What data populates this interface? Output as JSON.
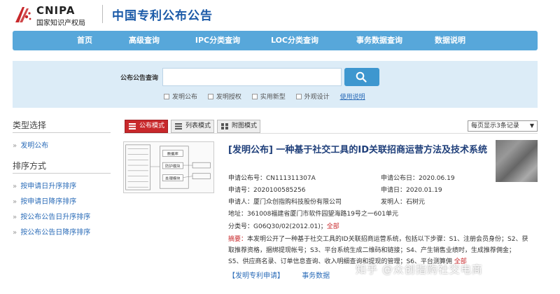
{
  "header": {
    "logo_text": "CNIPA",
    "logo_subtitle": "国家知识产权局",
    "site_title": "中国专利公布公告"
  },
  "nav": {
    "items": [
      "首页",
      "高级查询",
      "IPC分类查询",
      "LOC分类查询",
      "事务数据查询",
      "数据说明"
    ]
  },
  "search": {
    "label": "公布公告查询",
    "value": "",
    "options": [
      {
        "label": "发明公布",
        "checked": false
      },
      {
        "label": "发明授权",
        "checked": false
      },
      {
        "label": "实用新型",
        "checked": false
      },
      {
        "label": "外观设计",
        "checked": false
      }
    ],
    "help_link": "使用说明"
  },
  "sidebar": {
    "type_heading": "类型选择",
    "type_items": [
      "发明公布"
    ],
    "sort_heading": "排序方式",
    "sort_items": [
      "按申请日升序排序",
      "按申请日降序排序",
      "按公布公告日升序排序",
      "按公布公告日降序排序"
    ]
  },
  "toolbar": {
    "modes": [
      "公布模式",
      "列表模式",
      "附图模式"
    ],
    "active_mode": "公布模式",
    "per_page": "每页显示3条记录"
  },
  "result": {
    "title": "[发明公布] 一种基于社交工具的ID关联招商运营方法及技术系统",
    "pub_no_label": "申请公布号：",
    "pub_no": "CN111311307A",
    "pub_date_label": "申请公布日：",
    "pub_date": "2020.06.19",
    "app_no_label": "申请号：",
    "app_no": "2020100585256",
    "app_date_label": "申请日：",
    "app_date": "2020.01.19",
    "applicant_label": "申请人：",
    "applicant": "厦门众创指购科技股份有限公司",
    "inventor_label": "发明人：",
    "inventor": "石树元",
    "address_label": "地址：",
    "address": "361008福建省厦门市软件园望海路19号之一601单元",
    "class_label": "分类号：",
    "class_no": "G06Q30/02(2012.01)；",
    "class_all": "全部",
    "abstract_label": "摘要：",
    "abstract": "本发明公开了一种基于社交工具的ID关联招商运营系统，包括以下步骤：S1、注册会员身份；S2、获取推荐资格，捆绑提现帐号；S3、平台系统生成二维码和链接；S4、产生销售业绩时，生成推荐佣金；S5、供应商名录、订单信息查询、收入明细查询和提现的管理；S6、平台测算佣",
    "abstract_all": "全部",
    "links": [
      "【发明专利申请】",
      "事务数据"
    ],
    "diagram_boxes": [
      "数据库",
      "防护模块",
      "处理模块"
    ]
  },
  "watermark": "知乎 @众创指购社交电商",
  "colors": {
    "nav_bg": "#57a7da",
    "search_panel_bg": "#dcecf7",
    "active_tab": "#c8282b",
    "title_blue": "#1f3f7a",
    "link_blue": "#2b6cb8"
  }
}
